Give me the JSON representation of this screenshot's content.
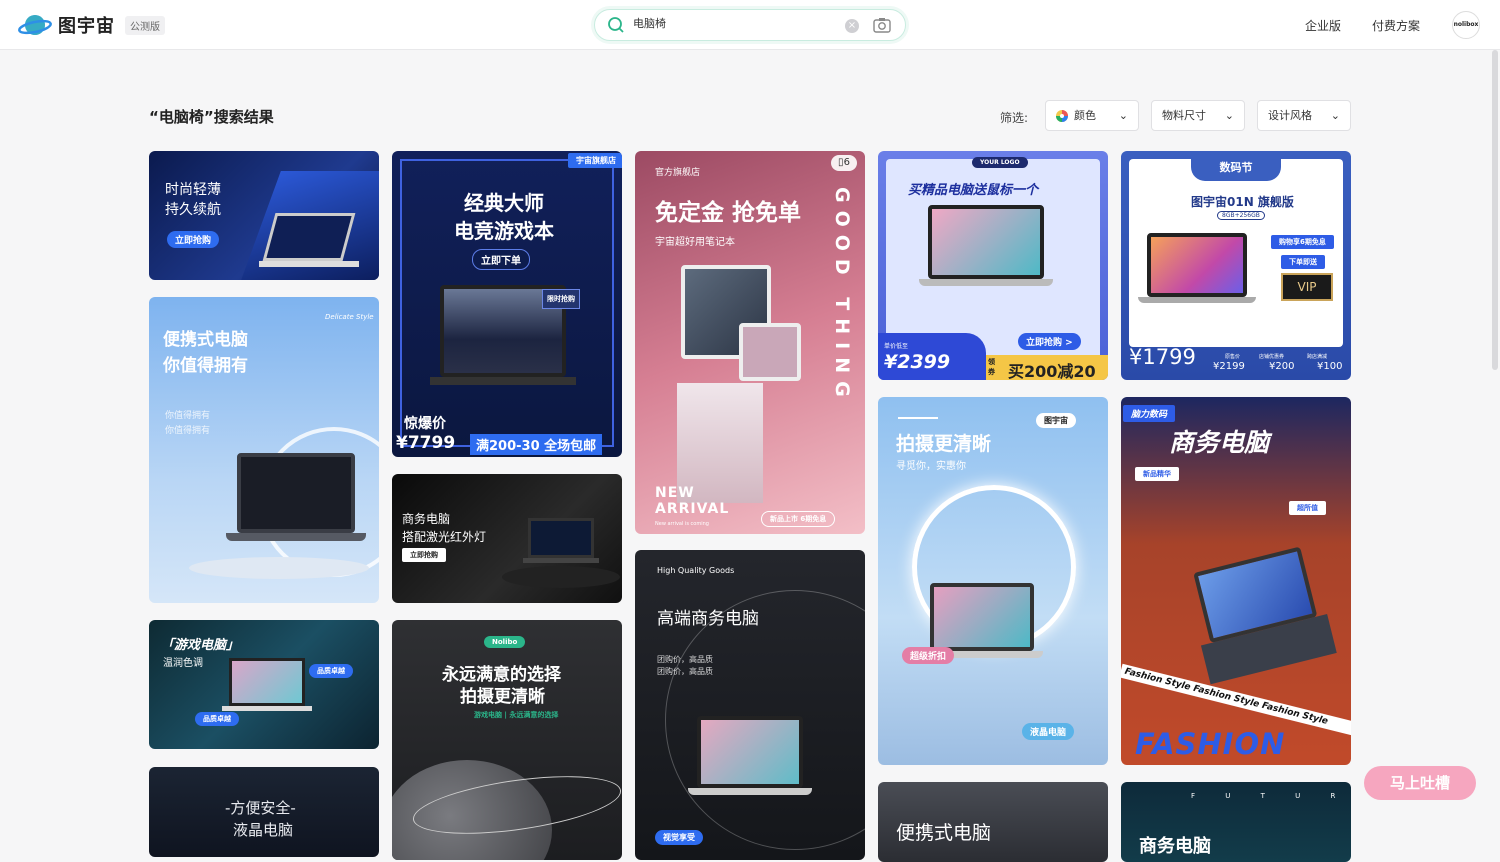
{
  "header": {
    "brand": "图宇宙",
    "badge": "公测版",
    "search": {
      "value": "电脑椅",
      "placeholder": "电脑椅"
    },
    "nav": [
      "企业版",
      "付费方案"
    ],
    "avatar": "nolibox"
  },
  "results": {
    "title": "“电脑椅”搜索结果",
    "filter_label": "筛选:",
    "filters": [
      {
        "label": "颜色"
      },
      {
        "label": "物料尺寸"
      },
      {
        "label": "设计风格"
      }
    ]
  },
  "cards": {
    "c1": {
      "line1": "时尚轻薄",
      "line2": "持久续航",
      "btn": "立即抢购"
    },
    "c2": {
      "line1": "便携式电脑",
      "line2": "你值得拥有",
      "sub1": "你值得拥有",
      "sub2": "你值得拥有",
      "script": "Delicate Style"
    },
    "c3": {
      "line1": "「游戏电脑」",
      "line2": "温润色调",
      "tag1": "品质卓越",
      "tag2": "品质卓越"
    },
    "c4": {
      "line1": "-方便安全-",
      "line2": "液晶电脑"
    },
    "c5": {
      "badge": "宇宙旗舰店",
      "line1": "经典大师",
      "line2": "电竞游戏本",
      "btn": "立即下单",
      "tag": "限时抢购",
      "price_label": "惊爆价",
      "price": "¥7799",
      "promo": "满200-30 全场包邮"
    },
    "c6": {
      "line1": "商务电脑",
      "line2": "搭配激光红外灯",
      "btn": "立即抢购"
    },
    "c7": {
      "tag": "Nolibo",
      "line1": "永远满意的选择",
      "line2": "拍摄更清晰",
      "sub": "游戏电脑 | 永远满意的选择"
    },
    "c8": {
      "store": "官方旗舰店",
      "title": "免定金 抢免单",
      "sub": "宇宙超好用笔记本",
      "vertical": "GOOD THING",
      "arrival1": "NEW",
      "arrival2": "ARRIVAL",
      "arrival_sub": "New arrival is coming",
      "badge": "新品上市 6期免息",
      "count": "6"
    },
    "c9": {
      "eyebrow": "High Quality Goods",
      "title": "高端商务电脑",
      "sub1": "团购价，高品质",
      "sub2": "团购价，高品质",
      "tag": "视觉享受"
    },
    "c10": {
      "title": "买精品电脑送鼠标一个",
      "btn": "立即抢购 >",
      "price_label": "单价低至",
      "price": "¥2399",
      "coupon": "领券",
      "promo": "买200减20",
      "logo": "YOUR LOGO"
    },
    "c11": {
      "title": "拍摄更清晰",
      "sub": "寻觅你，实惠你",
      "badge": "图宇宙",
      "tag1": "超级折扣",
      "tag2": "液晶电脑"
    },
    "c12": {
      "title": "便携式电脑"
    },
    "c13": {
      "header": "数码节",
      "title": "图宇宙01N 旗舰版",
      "spec": "8GB+256GB",
      "promo1": "购物享6期免息",
      "promo2": "下单即送",
      "vip": "VIP",
      "price_label": "限时特价",
      "price": "¥1799",
      "p1": "¥2199",
      "p2": "¥200",
      "p3": "¥100",
      "l1": "原售价",
      "l2": "店铺优惠券",
      "l3": "跨店满减"
    },
    "c14": {
      "tag": "脑力数码",
      "title": "商务电脑",
      "tag2": "新品精华",
      "tag3": "超所值",
      "band": "Fashion Style Fashion Style Fashion Style",
      "big": "FASHION"
    },
    "c15": {
      "letters": "F U T U R E",
      "title": "商务电脑"
    }
  },
  "feedback": "马上吐槽",
  "colors": {
    "accent": "#2bb58a"
  }
}
